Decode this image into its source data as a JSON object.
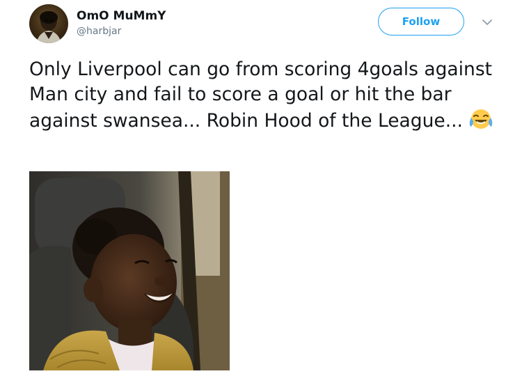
{
  "tweet": {
    "author": {
      "display_name": "OmO MuMmY",
      "handle": "@harbjar",
      "avatar_icon": "profile-photo"
    },
    "follow_label": "Follow",
    "menu_icon": "chevron-down-icon",
    "text": "Only Liverpool can go from scoring 4goals against Man city and fail to score a goal or hit the bar against swansea...  Robin Hood of the League...",
    "emoji": "face-with-tears-of-joy",
    "media": {
      "type": "image",
      "subject": "laughing child in car seat"
    }
  },
  "colors": {
    "accent": "#1da1f2",
    "text": "#14171a",
    "secondary_text": "#657786"
  }
}
